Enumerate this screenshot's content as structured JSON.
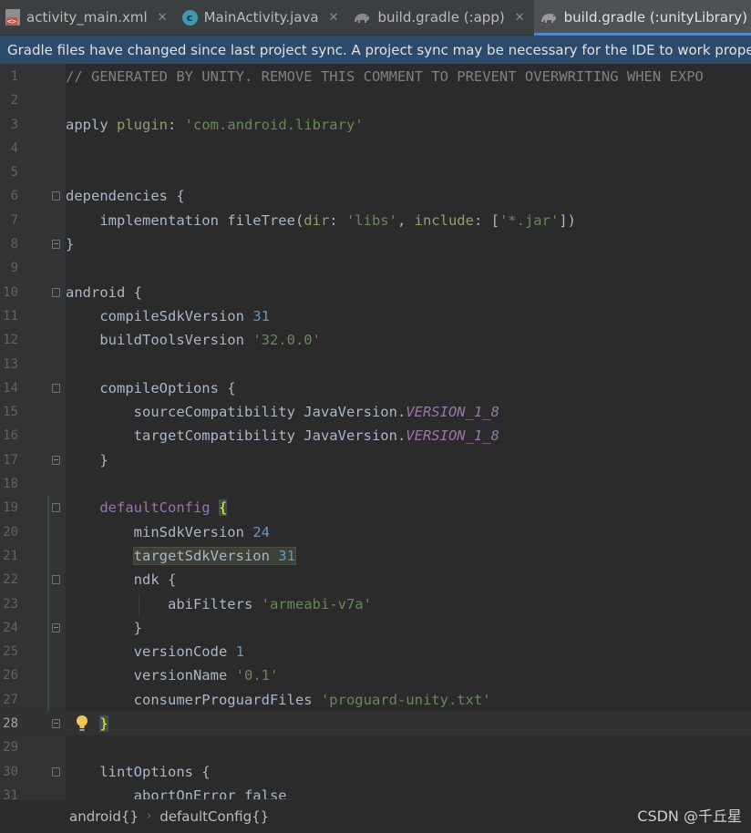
{
  "tabs": [
    {
      "label": "activity_main.xml",
      "icon": "xml-file-icon",
      "active": false
    },
    {
      "label": "MainActivity.java",
      "icon": "java-class-icon",
      "active": false
    },
    {
      "label": "build.gradle (:app)",
      "icon": "gradle-icon",
      "active": false
    },
    {
      "label": "build.gradle (:unityLibrary)",
      "icon": "gradle-icon",
      "active": true
    }
  ],
  "banner": {
    "text": "Gradle files have changed since last project sync. A project sync may be necessary for the IDE to work properly."
  },
  "editor": {
    "current_line": 28,
    "lines": [
      "// GENERATED BY UNITY. REMOVE THIS COMMENT TO PREVENT OVERWRITING WHEN EXPO",
      "",
      "apply plugin: 'com.android.library'",
      "",
      "",
      "dependencies {",
      "    implementation fileTree(dir: 'libs', include: ['*.jar'])",
      "}",
      "",
      "android {",
      "    compileSdkVersion 31",
      "    buildToolsVersion '32.0.0'",
      "",
      "    compileOptions {",
      "        sourceCompatibility JavaVersion.VERSION_1_8",
      "        targetCompatibility JavaVersion.VERSION_1_8",
      "    }",
      "",
      "    defaultConfig {",
      "        minSdkVersion 24",
      "        targetSdkVersion 31",
      "        ndk {",
      "            abiFilters 'armeabi-v7a'",
      "        }",
      "        versionCode 1",
      "        versionName '0.1'",
      "        consumerProguardFiles 'proguard-unity.txt'",
      "    }",
      "",
      "    lintOptions {",
      "        abortOnError false"
    ]
  },
  "breadcrumbs": [
    "android{}",
    "defaultConfig{}"
  ],
  "watermark": "CSDN @千丘星",
  "colors": {
    "background": "#2b2b2b",
    "banner": "#2e4a6b",
    "string": "#6a8759",
    "number": "#6897bb",
    "keyword_purple": "#9876aa"
  }
}
